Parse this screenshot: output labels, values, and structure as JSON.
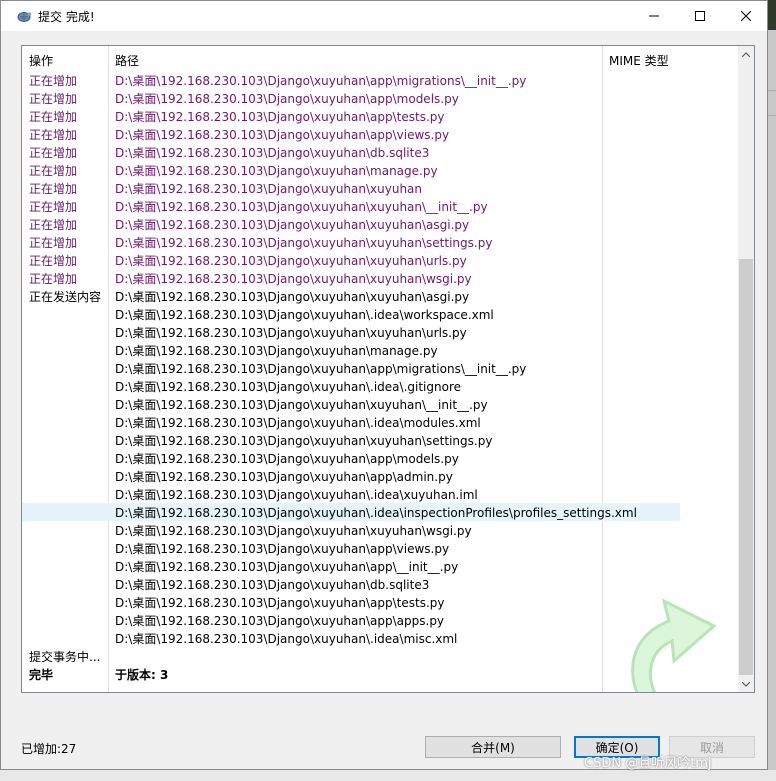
{
  "window": {
    "title": "提交 完成!"
  },
  "list": {
    "headers": {
      "action": "操作",
      "path": "路径",
      "mime": "MIME 类型"
    },
    "rows": [
      {
        "action": "正在增加",
        "path": "D:\\桌面\\192.168.230.103\\Django\\xuyuhan\\app\\migrations\\__init__.py",
        "type": "added"
      },
      {
        "action": "正在增加",
        "path": "D:\\桌面\\192.168.230.103\\Django\\xuyuhan\\app\\models.py",
        "type": "added"
      },
      {
        "action": "正在增加",
        "path": "D:\\桌面\\192.168.230.103\\Django\\xuyuhan\\app\\tests.py",
        "type": "added"
      },
      {
        "action": "正在增加",
        "path": "D:\\桌面\\192.168.230.103\\Django\\xuyuhan\\app\\views.py",
        "type": "added"
      },
      {
        "action": "正在增加",
        "path": "D:\\桌面\\192.168.230.103\\Django\\xuyuhan\\db.sqlite3",
        "type": "added"
      },
      {
        "action": "正在增加",
        "path": "D:\\桌面\\192.168.230.103\\Django\\xuyuhan\\manage.py",
        "type": "added"
      },
      {
        "action": "正在增加",
        "path": "D:\\桌面\\192.168.230.103\\Django\\xuyuhan\\xuyuhan",
        "type": "added"
      },
      {
        "action": "正在增加",
        "path": "D:\\桌面\\192.168.230.103\\Django\\xuyuhan\\xuyuhan\\__init__.py",
        "type": "added"
      },
      {
        "action": "正在增加",
        "path": "D:\\桌面\\192.168.230.103\\Django\\xuyuhan\\xuyuhan\\asgi.py",
        "type": "added"
      },
      {
        "action": "正在增加",
        "path": "D:\\桌面\\192.168.230.103\\Django\\xuyuhan\\xuyuhan\\settings.py",
        "type": "added"
      },
      {
        "action": "正在增加",
        "path": "D:\\桌面\\192.168.230.103\\Django\\xuyuhan\\xuyuhan\\urls.py",
        "type": "added"
      },
      {
        "action": "正在增加",
        "path": "D:\\桌面\\192.168.230.103\\Django\\xuyuhan\\xuyuhan\\wsgi.py",
        "type": "added"
      },
      {
        "action": "正在发送内容",
        "path": "D:\\桌面\\192.168.230.103\\Django\\xuyuhan\\xuyuhan\\asgi.py",
        "type": "normal"
      },
      {
        "action": "",
        "path": "D:\\桌面\\192.168.230.103\\Django\\xuyuhan\\.idea\\workspace.xml",
        "type": "normal"
      },
      {
        "action": "",
        "path": "D:\\桌面\\192.168.230.103\\Django\\xuyuhan\\xuyuhan\\urls.py",
        "type": "normal"
      },
      {
        "action": "",
        "path": "D:\\桌面\\192.168.230.103\\Django\\xuyuhan\\manage.py",
        "type": "normal"
      },
      {
        "action": "",
        "path": "D:\\桌面\\192.168.230.103\\Django\\xuyuhan\\app\\migrations\\__init__.py",
        "type": "normal"
      },
      {
        "action": "",
        "path": "D:\\桌面\\192.168.230.103\\Django\\xuyuhan\\.idea\\.gitignore",
        "type": "normal"
      },
      {
        "action": "",
        "path": "D:\\桌面\\192.168.230.103\\Django\\xuyuhan\\xuyuhan\\__init__.py",
        "type": "normal"
      },
      {
        "action": "",
        "path": "D:\\桌面\\192.168.230.103\\Django\\xuyuhan\\.idea\\modules.xml",
        "type": "normal"
      },
      {
        "action": "",
        "path": "D:\\桌面\\192.168.230.103\\Django\\xuyuhan\\xuyuhan\\settings.py",
        "type": "normal"
      },
      {
        "action": "",
        "path": "D:\\桌面\\192.168.230.103\\Django\\xuyuhan\\app\\models.py",
        "type": "normal"
      },
      {
        "action": "",
        "path": "D:\\桌面\\192.168.230.103\\Django\\xuyuhan\\app\\admin.py",
        "type": "normal"
      },
      {
        "action": "",
        "path": "D:\\桌面\\192.168.230.103\\Django\\xuyuhan\\.idea\\xuyuhan.iml",
        "type": "normal"
      },
      {
        "action": "",
        "path": "D:\\桌面\\192.168.230.103\\Django\\xuyuhan\\.idea\\inspectionProfiles\\profiles_settings.xml",
        "type": "selected"
      },
      {
        "action": "",
        "path": "D:\\桌面\\192.168.230.103\\Django\\xuyuhan\\xuyuhan\\wsgi.py",
        "type": "normal"
      },
      {
        "action": "",
        "path": "D:\\桌面\\192.168.230.103\\Django\\xuyuhan\\app\\views.py",
        "type": "normal"
      },
      {
        "action": "",
        "path": "D:\\桌面\\192.168.230.103\\Django\\xuyuhan\\app\\__init__.py",
        "type": "normal"
      },
      {
        "action": "",
        "path": "D:\\桌面\\192.168.230.103\\Django\\xuyuhan\\db.sqlite3",
        "type": "normal"
      },
      {
        "action": "",
        "path": "D:\\桌面\\192.168.230.103\\Django\\xuyuhan\\app\\tests.py",
        "type": "normal"
      },
      {
        "action": "",
        "path": "D:\\桌面\\192.168.230.103\\Django\\xuyuhan\\app\\apps.py",
        "type": "normal"
      },
      {
        "action": "",
        "path": "D:\\桌面\\192.168.230.103\\Django\\xuyuhan\\.idea\\misc.xml",
        "type": "normal"
      },
      {
        "action": "提交事务中...",
        "path": "",
        "type": "normal"
      },
      {
        "action": "完毕",
        "path": "于版本: 3",
        "type": "bold"
      }
    ]
  },
  "status": {
    "text": "已增加:27"
  },
  "buttons": {
    "merge": "合并(M)",
    "ok": "确定(O)",
    "cancel": "取消"
  },
  "watermark": "CSDN @且听风吟tmj",
  "icons": {
    "app": "tortoise-icon",
    "arrow": "commit-arrow-icon"
  }
}
